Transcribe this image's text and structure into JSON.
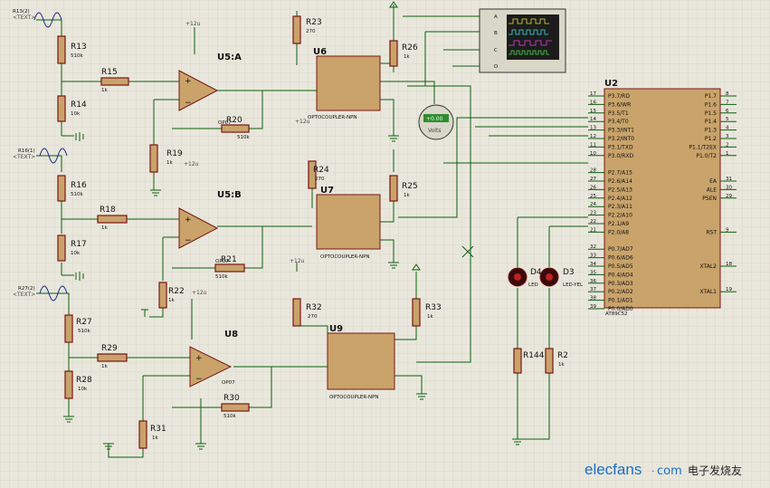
{
  "resistors": [
    {
      "name": "R13",
      "value": "510k"
    },
    {
      "name": "R14",
      "value": "10k"
    },
    {
      "name": "R15",
      "value": "1k"
    },
    {
      "name": "R16",
      "value": "510k"
    },
    {
      "name": "R17",
      "value": "10k"
    },
    {
      "name": "R18",
      "value": "1k"
    },
    {
      "name": "R19",
      "value": "1k"
    },
    {
      "name": "R20",
      "value": "510k"
    },
    {
      "name": "R21",
      "value": "510k"
    },
    {
      "name": "R22",
      "value": "1k"
    },
    {
      "name": "R23",
      "value": "270"
    },
    {
      "name": "R24",
      "value": "270"
    },
    {
      "name": "R25",
      "value": "1k"
    },
    {
      "name": "R26",
      "value": "1k"
    },
    {
      "name": "R27",
      "value": "510k"
    },
    {
      "name": "R28",
      "value": "10k"
    },
    {
      "name": "R29",
      "value": "1k"
    },
    {
      "name": "R30",
      "value": "510k"
    },
    {
      "name": "R31",
      "value": "1k"
    },
    {
      "name": "R32",
      "value": "270"
    },
    {
      "name": "R33",
      "value": "1k"
    },
    {
      "name": "R144",
      "value": ""
    },
    {
      "name": "R2",
      "value": "1k"
    }
  ],
  "text_placeholder": "<TEXT>",
  "sources": [
    "R13(2)",
    "R16(1)",
    "R27(2)"
  ],
  "opamps": [
    {
      "name": "U5:A",
      "type": "OP07"
    },
    {
      "name": "U5:B",
      "type": "OP07"
    },
    {
      "name": "U8",
      "type": "OP07"
    }
  ],
  "optocouplers": [
    {
      "name": "U6",
      "type": "OPTOCOUPLER-NPN"
    },
    {
      "name": "U7",
      "type": "OPTOCOUPLER-NPN"
    },
    {
      "name": "U9",
      "type": "OPTOCOUPLER-NPN"
    }
  ],
  "supply_label": "+12u",
  "voltmeter": {
    "reading": "+0.00",
    "unit": "Volts"
  },
  "oscilloscope": {
    "channels": [
      "A",
      "B",
      "C",
      "D"
    ]
  },
  "mcu": {
    "name": "U2",
    "part": "AT89C52",
    "left_pins": [
      {
        "num": "17",
        "name": "P3.7/RD"
      },
      {
        "num": "16",
        "name": "P3.6/WR"
      },
      {
        "num": "15",
        "name": "P3.5/T1"
      },
      {
        "num": "14",
        "name": "P3.4/T0"
      },
      {
        "num": "13",
        "name": "P3.3/INT1"
      },
      {
        "num": "12",
        "name": "P3.2/INT0"
      },
      {
        "num": "11",
        "name": "P3.1/TXD"
      },
      {
        "num": "10",
        "name": "P3.0/RXD"
      },
      {
        "num": "28",
        "name": "P2.7/A15"
      },
      {
        "num": "27",
        "name": "P2.6/A14"
      },
      {
        "num": "26",
        "name": "P2.5/A13"
      },
      {
        "num": "25",
        "name": "P2.4/A12"
      },
      {
        "num": "24",
        "name": "P2.3/A11"
      },
      {
        "num": "23",
        "name": "P2.2/A10"
      },
      {
        "num": "22",
        "name": "P2.1/A9"
      },
      {
        "num": "21",
        "name": "P2.0/A8"
      },
      {
        "num": "32",
        "name": "P0.7/AD7"
      },
      {
        "num": "33",
        "name": "P0.6/AD6"
      },
      {
        "num": "34",
        "name": "P0.5/AD5"
      },
      {
        "num": "35",
        "name": "P0.4/AD4"
      },
      {
        "num": "36",
        "name": "P0.3/AD3"
      },
      {
        "num": "37",
        "name": "P0.2/AD2"
      },
      {
        "num": "38",
        "name": "P0.1/AD1"
      },
      {
        "num": "39",
        "name": "P0.0/AD0"
      }
    ],
    "right_pins": [
      {
        "num": "8",
        "name": "P1.7"
      },
      {
        "num": "7",
        "name": "P1.6"
      },
      {
        "num": "6",
        "name": "P1.5"
      },
      {
        "num": "5",
        "name": "P1.4"
      },
      {
        "num": "4",
        "name": "P1.3"
      },
      {
        "num": "3",
        "name": "P1.2"
      },
      {
        "num": "2",
        "name": "P1.1/T2EX"
      },
      {
        "num": "1",
        "name": "P1.0/T2"
      },
      {
        "num": "31",
        "name": "EA"
      },
      {
        "num": "30",
        "name": "ALE"
      },
      {
        "num": "29",
        "name": "PSEN"
      },
      {
        "num": "9",
        "name": "RST"
      },
      {
        "num": "18",
        "name": "XTAL2"
      },
      {
        "num": "19",
        "name": "XTAL1"
      }
    ]
  },
  "leds": [
    {
      "name": "D4",
      "type": "LED"
    },
    {
      "name": "D3",
      "type": "LED-YEL"
    }
  ],
  "watermark": {
    "brand": "elecfans",
    "domain": "com",
    "cn": "电子发烧友"
  }
}
